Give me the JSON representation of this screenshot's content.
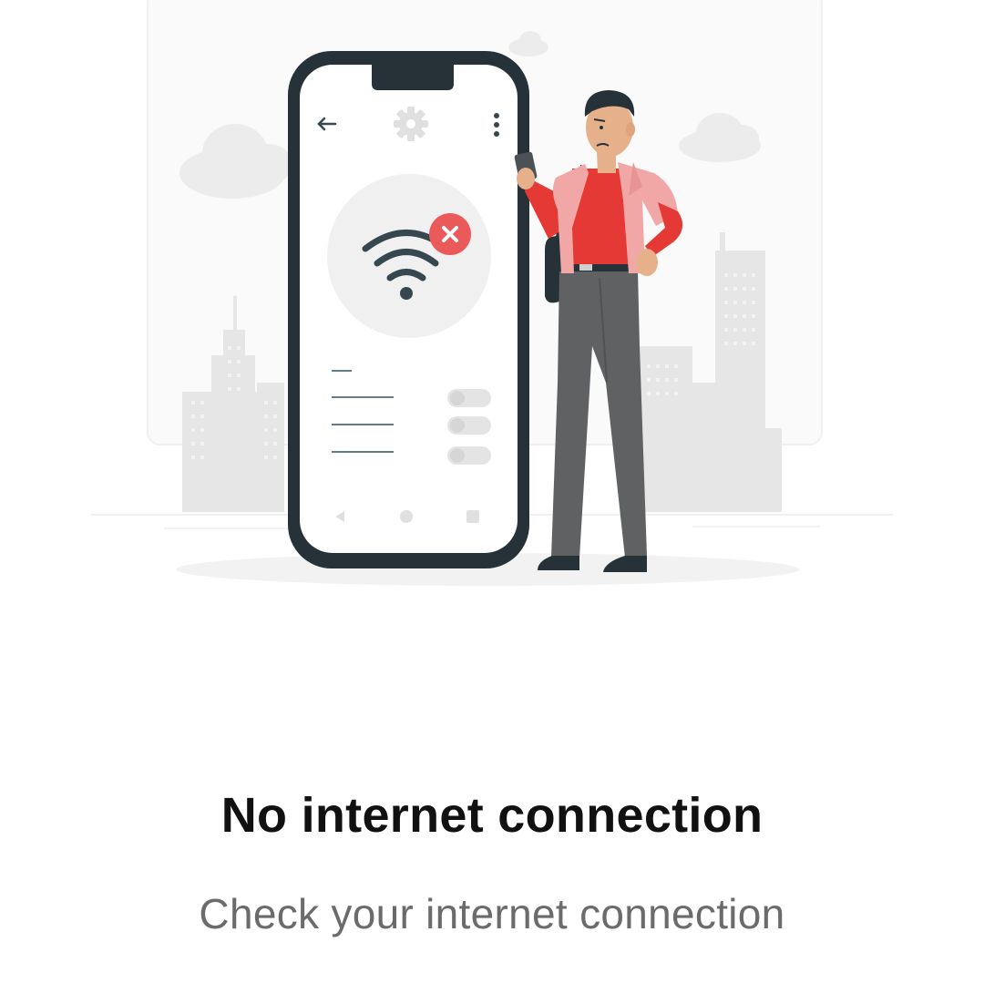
{
  "message": {
    "title": "No internet connection",
    "subtitle": "Check your internet connection"
  },
  "illustration": {
    "phone_icons": [
      "back-arrow-icon",
      "gear-icon",
      "more-vert-icon",
      "wifi-off-icon",
      "close-icon"
    ],
    "colors": {
      "phone_frame": "#263238",
      "wifi": "#37474f",
      "error_badge": "#eb5a5a",
      "shirt": "#e53935",
      "overshirt": "#f2a7a7",
      "pants": "#5f6163",
      "city": "#e6e6e6",
      "clouds": "#ececec"
    }
  }
}
